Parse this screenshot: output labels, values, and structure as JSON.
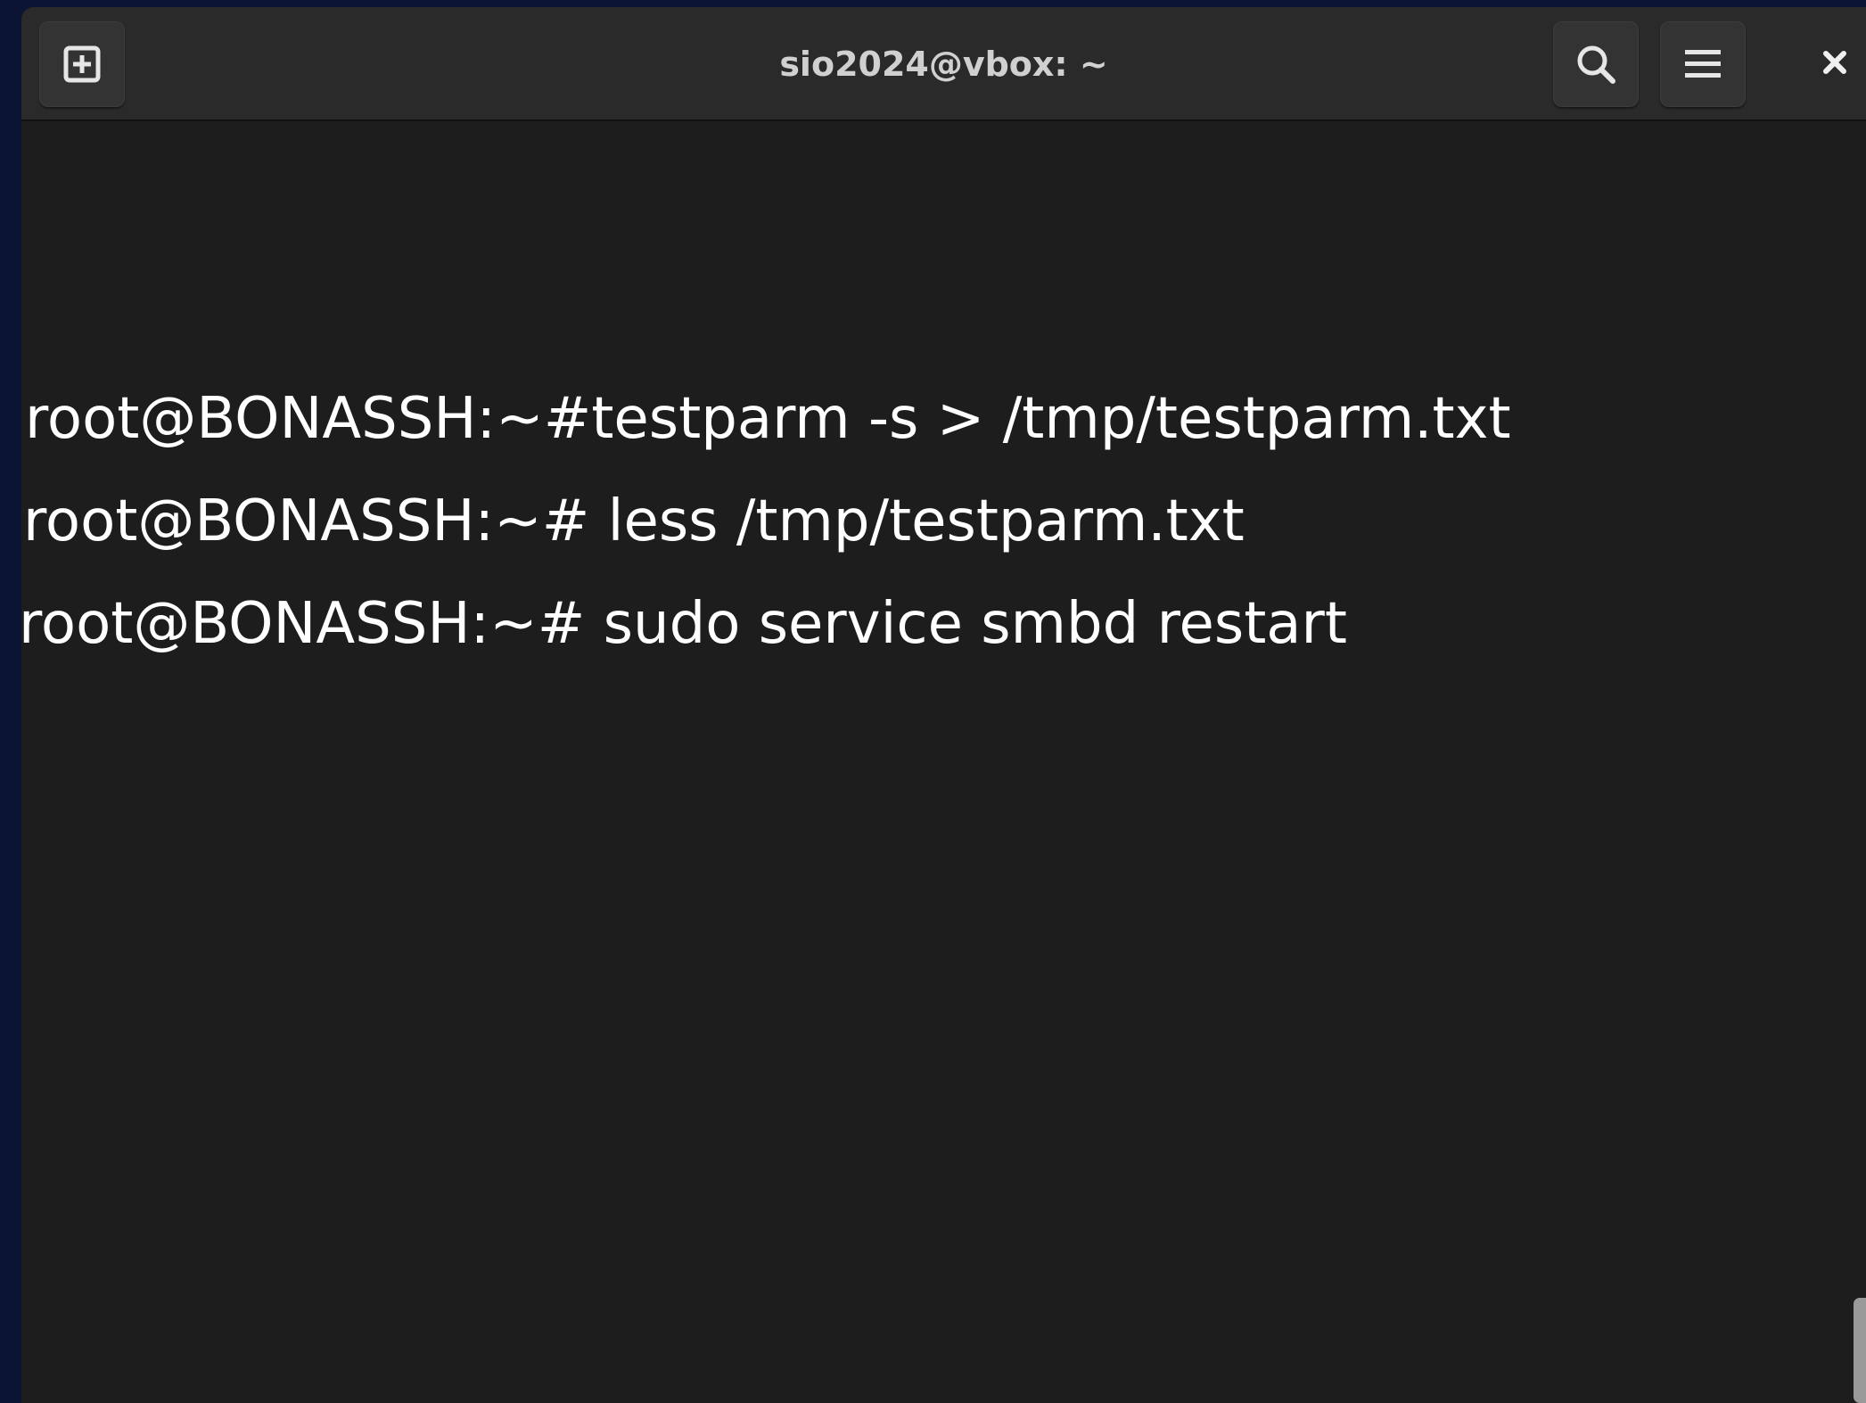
{
  "window": {
    "title": "sio2024@vbox: ~"
  },
  "headerbar": {
    "new_tab_icon": "new-tab-icon",
    "search_icon": "search-icon",
    "menu_icon": "hamburger-menu-icon",
    "close_icon": "close-icon"
  },
  "terminal": {
    "lines": [
      "root@BONASSH:~#testparm -s > /tmp/testparm.txt",
      "root@BONASSH:~# less /tmp/testparm.txt",
      "root@BONASSH:~# sudo service smbd restart"
    ]
  },
  "colors": {
    "desktop_background": "#0c1434",
    "terminal_background": "#1d1d1d",
    "headerbar_background": "#2a2a2a",
    "text": "#ffffff"
  }
}
